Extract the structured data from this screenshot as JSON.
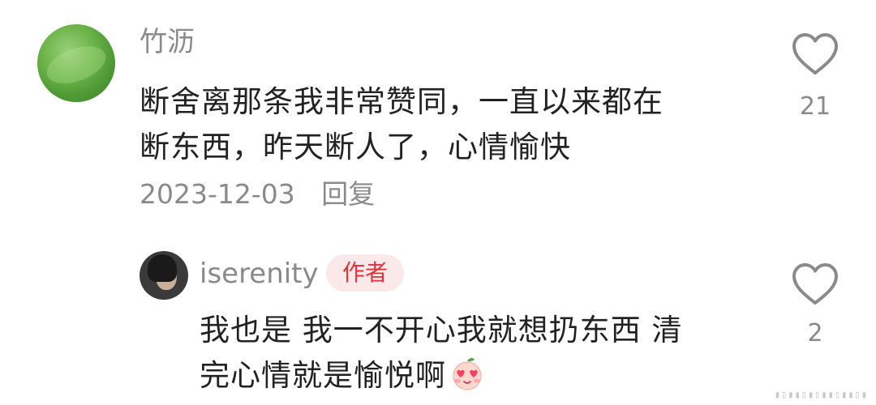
{
  "comments": [
    {
      "username": "竹沥",
      "text_line1": "断舍离那条我非常赞同，一直以来都在",
      "text_line2": "断东西，昨天断人了，心情愉快",
      "date": "2023-12-03",
      "reply_label": "回复",
      "likes": "21"
    }
  ],
  "reply": {
    "username": "iserenity",
    "badge": "作者",
    "text_line1": "我也是 我一不开心我就想扔东西 清",
    "text_line2": "完心情就是愉悦啊",
    "emoji": "smiling-face-with-heart-eyes-emoji",
    "likes": "2"
  },
  "icons": {
    "like": "heart-outline-icon"
  },
  "colors": {
    "primary_text": "#222222",
    "secondary_text": "#8a8a8a",
    "badge_text": "#e0323c",
    "badge_bg": "#fbe9ea"
  }
}
